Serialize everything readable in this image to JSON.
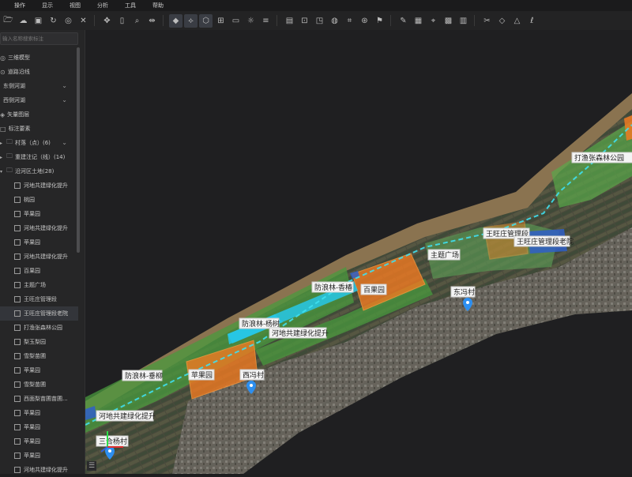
{
  "menu": [
    "操作",
    "显示",
    "视图",
    "分析",
    "工具",
    "帮助"
  ],
  "toolbar_icons": [
    "folder-open-icon",
    "cloud-icon",
    "save-icon",
    "refresh-icon",
    "target-icon",
    "close-icon",
    "move-icon",
    "document-icon",
    "zoom-icon",
    "measure-icon",
    "layers-icon",
    "node-icon",
    "polygon-icon",
    "frame-icon",
    "monitor-icon",
    "sun-icon",
    "sliders-icon",
    "image-icon",
    "focus-icon",
    "window-icon",
    "globe-icon",
    "crop-icon",
    "compass-icon",
    "flag-icon",
    "edit-icon",
    "panel-icon",
    "pin-icon",
    "grid-icon",
    "table-icon",
    "scissors-icon",
    "shapes-icon",
    "warning-icon",
    "brush-icon"
  ],
  "sidebar": {
    "search_placeholder": "输入名称搜索标注",
    "items": [
      {
        "label": "三维模型",
        "type": "top",
        "ico": "◎"
      },
      {
        "label": "道路沿线",
        "type": "top",
        "ico": "⊙"
      },
      {
        "label": "东侧河湖",
        "type": "sub",
        "chev": true
      },
      {
        "label": "西侧河湖",
        "type": "sub",
        "chev": true
      },
      {
        "label": "矢量图层",
        "type": "top",
        "ico": "◈"
      },
      {
        "label": "标注要素",
        "type": "top",
        "ico": "□"
      },
      {
        "label": "村落（点）(6)",
        "type": "folder",
        "chev": true
      },
      {
        "label": "重建注记（线）(14)",
        "type": "folder"
      },
      {
        "label": "沿河区土地(28)",
        "type": "folder-open"
      },
      {
        "label": "河地共建绿化提升",
        "type": "leaf"
      },
      {
        "label": "桃园",
        "type": "leaf"
      },
      {
        "label": "苹果园",
        "type": "leaf"
      },
      {
        "label": "河地共建绿化提升",
        "type": "leaf"
      },
      {
        "label": "苹果园",
        "type": "leaf"
      },
      {
        "label": "河地共建绿化提升",
        "type": "leaf"
      },
      {
        "label": "百果园",
        "type": "leaf"
      },
      {
        "label": "主题广场",
        "type": "leaf"
      },
      {
        "label": "王旺庄管理段",
        "type": "leaf"
      },
      {
        "label": "王旺庄管理段老院",
        "type": "leaf",
        "selected": true
      },
      {
        "label": "打渔张森林公园",
        "type": "leaf"
      },
      {
        "label": "梨玉梨园",
        "type": "leaf"
      },
      {
        "label": "雪梨苗圃",
        "type": "leaf"
      },
      {
        "label": "苹果园",
        "type": "leaf"
      },
      {
        "label": "雪梨苗圃",
        "type": "leaf"
      },
      {
        "label": "西面梨苗圃苗圃...",
        "type": "leaf"
      },
      {
        "label": "苹果园",
        "type": "leaf"
      },
      {
        "label": "苹果园",
        "type": "leaf"
      },
      {
        "label": "苹果园",
        "type": "leaf"
      },
      {
        "label": "苹果园",
        "type": "leaf"
      },
      {
        "label": "河地共建绿化提升",
        "type": "leaf"
      }
    ]
  },
  "map": {
    "labels": {
      "park": "打渔张森林公园",
      "mgmt": "王旺庄管理段",
      "mgmt_old": "王旺庄管理段老院",
      "plaza": "主题广场",
      "village1": "东冯村",
      "baiguo": "百果园",
      "fanglin1": "防浪林-香椿",
      "fanglin2": "防浪林-杨树",
      "fanglin3": "防浪林-垂柳",
      "hedi1": "河地共建绿化提升",
      "hedi2": "河地共建绿化提升",
      "apple": "苹果园",
      "village2": "西冯村",
      "village3": "三合杨村"
    }
  },
  "bottom_button": "☰"
}
